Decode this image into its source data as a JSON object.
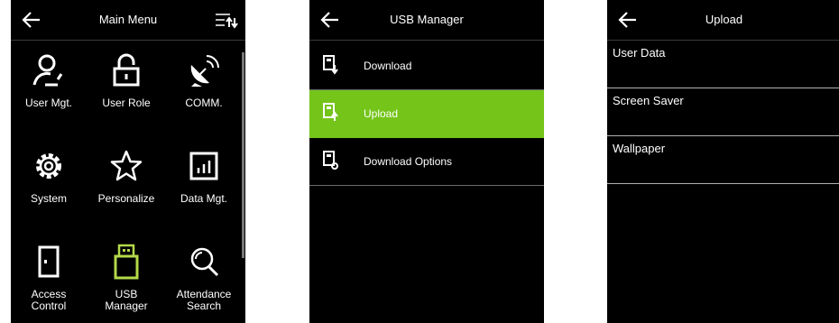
{
  "main_menu": {
    "title": "Main Menu",
    "items": [
      {
        "label": "User Mgt.",
        "icon": "user-icon"
      },
      {
        "label": "User Role",
        "icon": "lock-icon"
      },
      {
        "label": "COMM.",
        "icon": "satellite-dish-icon"
      },
      {
        "label": "System",
        "icon": "gear-icon"
      },
      {
        "label": "Personalize",
        "icon": "star-icon"
      },
      {
        "label": "Data Mgt.",
        "icon": "bar-chart-icon"
      },
      {
        "label": "Access\nControl",
        "icon": "door-icon"
      },
      {
        "label": "USB\nManager",
        "icon": "usb-drive-icon"
      },
      {
        "label": "Attendance\nSearch",
        "icon": "search-icon"
      }
    ]
  },
  "usb_manager": {
    "title": "USB Manager",
    "items": [
      {
        "label": "Download",
        "icon": "usb-download-icon"
      },
      {
        "label": "Upload",
        "icon": "usb-upload-icon"
      },
      {
        "label": "Download Options",
        "icon": "usb-options-icon"
      }
    ],
    "selected": "Upload"
  },
  "upload": {
    "title": "Upload",
    "items": [
      "User Data",
      "Screen Saver",
      "Wallpaper"
    ]
  },
  "colors": {
    "background": "#000000",
    "highlight": "#74c41a",
    "usb_icon_accent": "#b4d94a"
  }
}
